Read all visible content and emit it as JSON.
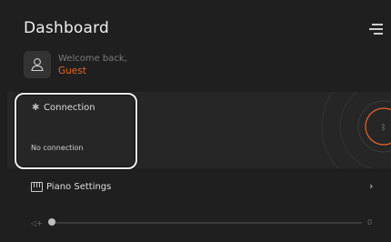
{
  "header": {
    "title": "Dashboard",
    "menu_icon": "hamburger-menu-icon"
  },
  "welcome": {
    "greeting": "Welcome back,",
    "name": "Guest",
    "avatar_icon": "user-icon"
  },
  "connection": {
    "icon": "bluetooth-icon",
    "icon_glyph": "✱",
    "title": "Connection",
    "status": "No connection"
  },
  "piano_settings": {
    "icon": "piano-icon",
    "label": "Piano Settings",
    "chevron": "›"
  },
  "volume": {
    "icon": "volume-icon",
    "icon_glyph": "◁+",
    "value": "0",
    "level": 0
  },
  "colors": {
    "accent": "#e8642c",
    "background": "#1f1f1f",
    "card": "#262626"
  }
}
